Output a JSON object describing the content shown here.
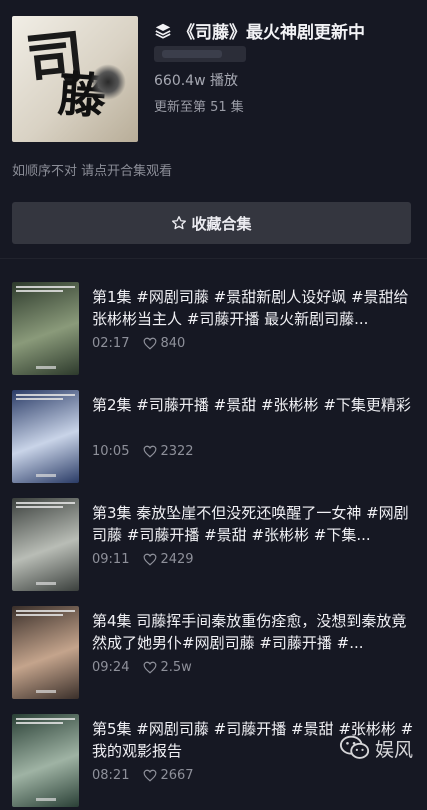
{
  "header": {
    "cover_text_1": "司",
    "cover_text_2": "藤",
    "title": "《司藤》最火神剧更新中",
    "plays": "660.4w 播放",
    "updated": "更新至第 51 集"
  },
  "hint": "如顺序不对  请点开合集观看",
  "collect_button": {
    "label": "收藏合集",
    "icon": "star-icon"
  },
  "episodes": [
    {
      "title": "第1集  #网剧司藤 #景甜新剧人设好飒 #景甜给张彬彬当主人 #司藤开播 最火新剧司藤...",
      "duration": "02:17",
      "likes": "840",
      "thumb_colors": [
        "#2d3a2c",
        "#8a9a7a"
      ]
    },
    {
      "title": "第2集  #司藤开播 #景甜 #张彬彬 #下集更精彩",
      "duration": "10:05",
      "likes": "2322",
      "thumb_colors": [
        "#2a3b66",
        "#c9d4e8"
      ]
    },
    {
      "title": "第3集  秦放坠崖不但没死还唤醒了一女神 #网剧司藤 #司藤开播 #景甜 #张彬彬 #下集...",
      "duration": "09:11",
      "likes": "2429",
      "thumb_colors": [
        "#3a3f3c",
        "#b9bdb6"
      ]
    },
    {
      "title": "第4集  司藤挥手间秦放重伤痊愈，没想到秦放竟然成了她男仆#网剧司藤 #司藤开播 #...",
      "duration": "09:24",
      "likes": "2.5w",
      "thumb_colors": [
        "#3a2f2a",
        "#c4a48c"
      ]
    },
    {
      "title": "第5集  #网剧司藤 #司藤开播 #景甜 #张彬彬 #我的观影报告",
      "duration": "08:21",
      "likes": "2667",
      "thumb_colors": [
        "#2a4036",
        "#9fb3a4"
      ]
    }
  ],
  "watermark": "娱风"
}
